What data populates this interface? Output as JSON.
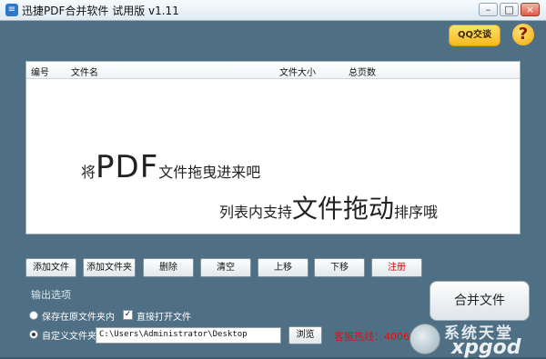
{
  "window": {
    "title": "迅捷PDF合并软件 试用版 v1.11",
    "minimize": "–",
    "maximize": "□",
    "close": "×"
  },
  "header": {
    "qq_label": "QQ交谈",
    "help_label": "?"
  },
  "file_list": {
    "columns": [
      "编号",
      "文件名",
      "文件大小",
      "总页数"
    ],
    "hint_line1_prefix": "将",
    "hint_line1_big": "PDF",
    "hint_line1_suffix": "文件拖曳进来吧",
    "hint_line2_prefix": "列表内支持",
    "hint_line2_big": "文件拖动",
    "hint_line2_suffix": "排序哦"
  },
  "toolbar": {
    "add_file": "添加文件",
    "add_folder": "添加文件夹",
    "delete": "删除",
    "clear": "清空",
    "move_up": "上移",
    "move_down": "下移",
    "register": "注册"
  },
  "output": {
    "section_title": "输出选项",
    "save_original_label": "保存在原文件夹内",
    "open_directly_label": "直接打开文件",
    "custom_folder_label": "自定义文件夹",
    "path_value": "C:\\Users\\Administrator\\Desktop",
    "browse_label": "浏览",
    "merge_label": "合并文件",
    "hotline": "客服热线：40066"
  },
  "watermark": {
    "line1": "系统天堂",
    "line2": "xpgod"
  },
  "colors": {
    "window_bg": "#4e6f84",
    "hotline": "#e01010",
    "register": "#d40000"
  }
}
